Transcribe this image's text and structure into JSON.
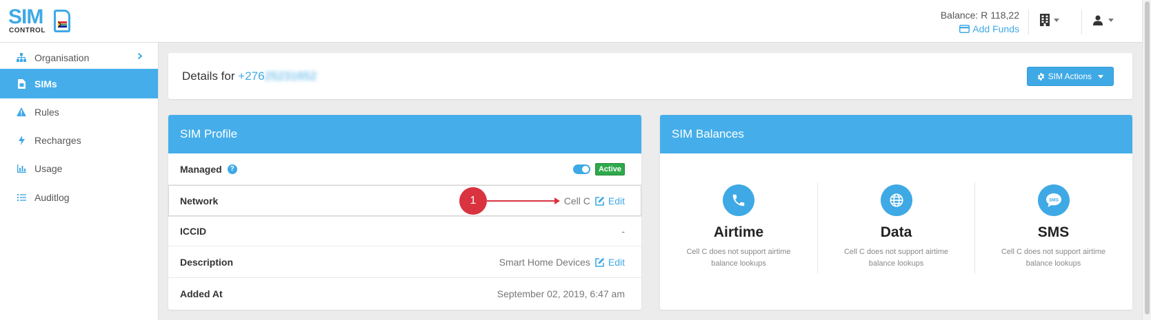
{
  "brand": {
    "logo_top": "SIM",
    "logo_bottom": "CONTROL",
    "accent": "#3fa9e5"
  },
  "header": {
    "balance": "Balance: R 118,22",
    "add_funds": "Add Funds"
  },
  "sidebar": {
    "items": [
      {
        "label": "Organisation",
        "icon": "sitemap-icon"
      },
      {
        "label": "SIMs",
        "icon": "sim-card-icon",
        "active": true
      },
      {
        "label": "Rules",
        "icon": "warning-icon"
      },
      {
        "label": "Recharges",
        "icon": "bolt-icon"
      },
      {
        "label": "Usage",
        "icon": "bar-chart-icon"
      },
      {
        "label": "Auditlog",
        "icon": "list-icon"
      }
    ]
  },
  "details": {
    "prefix": "Details for",
    "number_visible": "+276",
    "number_blurred": "25231652",
    "sim_actions": "SIM Actions"
  },
  "profile": {
    "title": "SIM Profile",
    "rows": [
      {
        "label": "Managed",
        "status": "Active"
      },
      {
        "label": "Network",
        "value": "Cell C",
        "edit": "Edit"
      },
      {
        "label": "ICCID",
        "value": "-"
      },
      {
        "label": "Description",
        "value": "Smart Home Devices",
        "edit": "Edit"
      },
      {
        "label": "Added At",
        "value": "September 02, 2019, 6:47 am"
      }
    ],
    "callout": "1"
  },
  "balances": {
    "title": "SIM Balances",
    "items": [
      {
        "title": "Airtime",
        "note": "Cell C does not support airtime balance lookups",
        "icon": "phone-icon"
      },
      {
        "title": "Data",
        "note": "Cell C does not support airtime balance lookups",
        "icon": "globe-icon"
      },
      {
        "title": "SMS",
        "note": "Cell C does not support airtime balance lookups",
        "icon": "sms-bubble-icon"
      }
    ]
  }
}
